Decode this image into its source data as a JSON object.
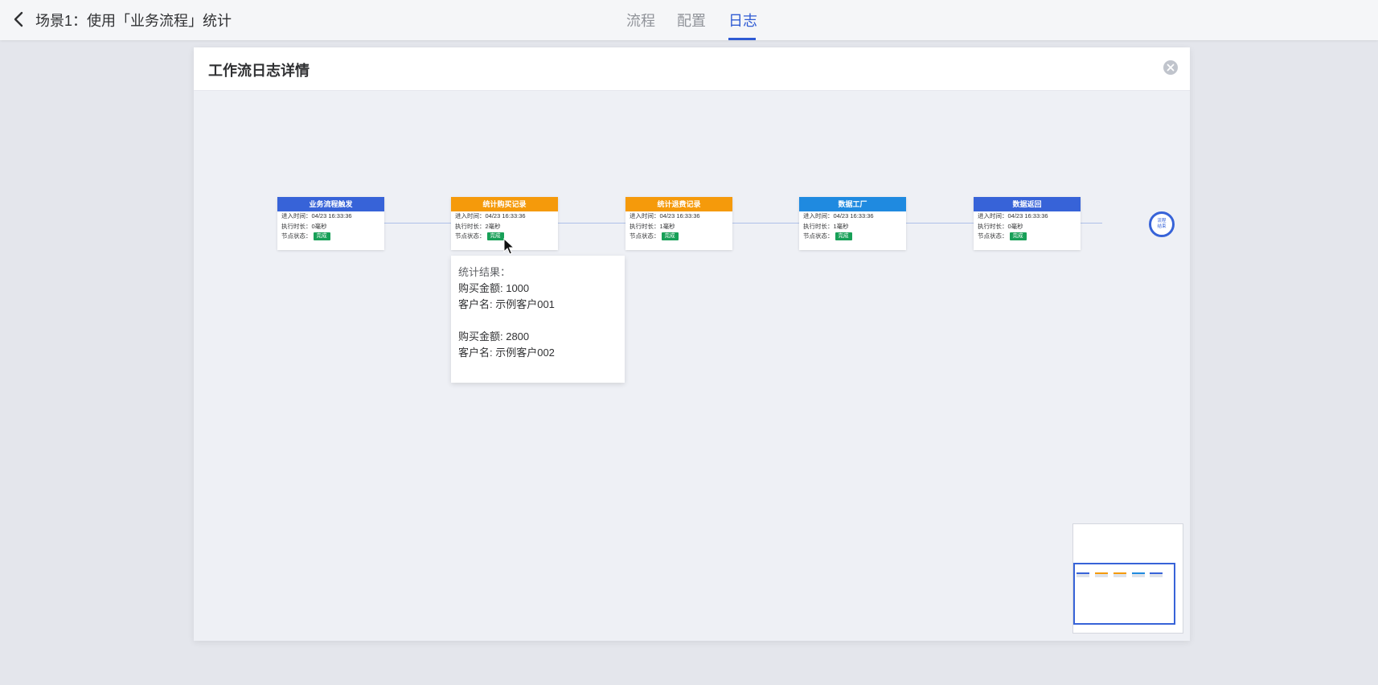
{
  "header": {
    "title": "场景1：使用「业务流程」统计",
    "tabs": [
      {
        "label": "流程",
        "active": false
      },
      {
        "label": "配置",
        "active": false
      },
      {
        "label": "日志",
        "active": true
      }
    ]
  },
  "dialog": {
    "title": "工作流日志详情",
    "nodes": [
      {
        "title": "业务流程触发",
        "color": "#3763d8",
        "enter_label": "进入时间：",
        "enter_time": "04/23 16:33:36",
        "duration_label": "执行时长：",
        "duration": "0毫秒",
        "status_label": "节点状态：",
        "status": "完成"
      },
      {
        "title": "统计购买记录",
        "color": "#f59a0b",
        "enter_label": "进入时间：",
        "enter_time": "04/23 16:33:36",
        "duration_label": "执行时长：",
        "duration": "2毫秒",
        "status_label": "节点状态：",
        "status": "完成"
      },
      {
        "title": "统计退费记录",
        "color": "#f59a0b",
        "enter_label": "进入时间：",
        "enter_time": "04/23 16:33:36",
        "duration_label": "执行时长：",
        "duration": "1毫秒",
        "status_label": "节点状态：",
        "status": "完成"
      },
      {
        "title": "数据工厂",
        "color": "#1f8ae0",
        "enter_label": "进入时间：",
        "enter_time": "04/23 16:33:36",
        "duration_label": "执行时长：",
        "duration": "1毫秒",
        "status_label": "节点状态：",
        "status": "完成"
      },
      {
        "title": "数据返回",
        "color": "#3763d8",
        "enter_label": "进入时间：",
        "enter_time": "04/23 16:33:36",
        "duration_label": "执行时长：",
        "duration": "0毫秒",
        "status_label": "节点状态：",
        "status": "完成"
      }
    ],
    "end_node": {
      "line1": "流程",
      "line2": "结束"
    },
    "tooltip": {
      "title": "统计结果：",
      "lines": [
        "购买金额: 1000",
        "客户名: 示例客户001",
        "购买金额: 2800",
        "客户名: 示例客户002"
      ]
    }
  },
  "colors": {
    "accent": "#2f5bd3",
    "status_done": "#18a058",
    "node_blue": "#3763d8",
    "node_orange": "#f59a0b",
    "node_sky": "#1f8ae0"
  },
  "icons": {
    "back": "chevron-left-icon",
    "close": "close-circle-icon",
    "cursor": "mouse-pointer-icon"
  }
}
